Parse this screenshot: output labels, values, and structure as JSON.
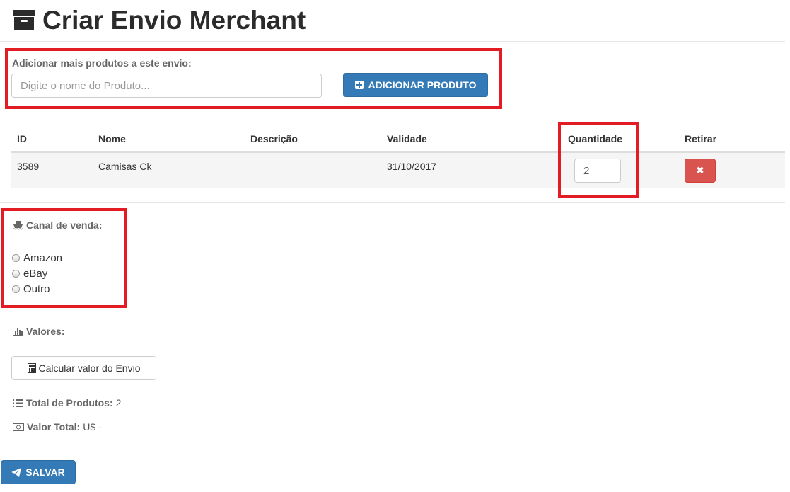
{
  "page": {
    "title": "Criar Envio Merchant"
  },
  "add_product": {
    "label": "Adicionar mais produtos a este envio:",
    "placeholder": "Digite o nome do Produto...",
    "button_label": "ADICIONAR PRODUTO"
  },
  "table": {
    "headers": [
      "ID",
      "Nome",
      "Descrição",
      "Validade",
      "Quantidade",
      "Retirar"
    ],
    "rows": [
      {
        "id": "3589",
        "nome": "Camisas Ck",
        "descricao": "",
        "validade": "31/10/2017",
        "quantidade": "2",
        "remove_icon": "times-icon"
      }
    ]
  },
  "sales_channel": {
    "label": "Canal de venda:",
    "options": [
      "Amazon",
      "eBay",
      "Outro"
    ]
  },
  "values": {
    "label": "Valores:",
    "calc_button": "Calcular valor do Envio",
    "total_products_label": "Total de Produtos:",
    "total_products_value": "2",
    "total_value_label": "Valor Total:",
    "total_value_value": "U$ -"
  },
  "save_button": "SALVAR",
  "colors": {
    "primary": "#337ab7",
    "danger": "#d9534f",
    "highlight": "#e31b23"
  }
}
